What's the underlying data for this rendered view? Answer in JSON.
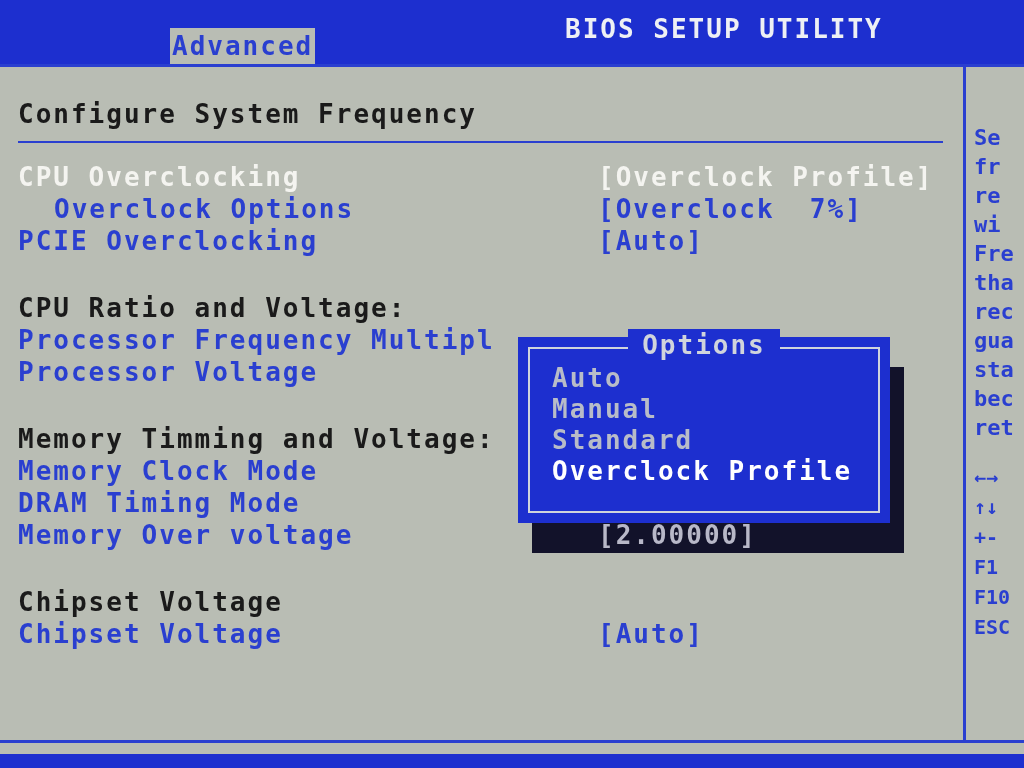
{
  "header": {
    "title": "BIOS SETUP UTILITY"
  },
  "tabs": [
    {
      "label": "Advanced",
      "selected": true
    }
  ],
  "panel": {
    "title": "Configure System Frequency"
  },
  "rows": [
    {
      "kind": "setting",
      "label": "CPU Overclocking",
      "value": "[Overclock Profile]",
      "selected": true
    },
    {
      "kind": "subsetting",
      "label": "Overclock Options",
      "value": "[Overclock  7%]",
      "selected": false
    },
    {
      "kind": "setting",
      "label": "PCIE Overclocking",
      "value": "[Auto]",
      "selected": false
    },
    {
      "kind": "gap"
    },
    {
      "kind": "heading",
      "label": "CPU Ratio and Voltage:"
    },
    {
      "kind": "setting",
      "label": "Processor Frequency Multipl",
      "selected": false
    },
    {
      "kind": "setting",
      "label": "Processor Voltage",
      "selected": false
    },
    {
      "kind": "gap"
    },
    {
      "kind": "heading",
      "label": "Memory Timming and Voltage:"
    },
    {
      "kind": "setting",
      "label": "Memory Clock Mode",
      "selected": false
    },
    {
      "kind": "setting",
      "label": "DRAM Timing Mode",
      "selected": false
    },
    {
      "kind": "setting",
      "label": "Memory Over voltage",
      "value": "[2.00000]",
      "selected": false,
      "shadowed": true
    },
    {
      "kind": "gap"
    },
    {
      "kind": "heading",
      "label": "Chipset Voltage"
    },
    {
      "kind": "setting",
      "label": "Chipset Voltage",
      "value": "[Auto]",
      "selected": false
    }
  ],
  "popup": {
    "title": "Options",
    "options": [
      {
        "label": "Auto",
        "selected": false
      },
      {
        "label": "Manual",
        "selected": false
      },
      {
        "label": "Standard",
        "selected": false
      },
      {
        "label": "Overclock Profile",
        "selected": true
      }
    ]
  },
  "help": {
    "lines": [
      "Se",
      "fr",
      "re",
      "wi",
      "Fre",
      "tha",
      "rec",
      "gua",
      "sta",
      "bec",
      "ret"
    ],
    "keys": [
      "←→",
      "↑↓",
      "+-",
      "F1",
      "F10",
      "ESC"
    ]
  }
}
